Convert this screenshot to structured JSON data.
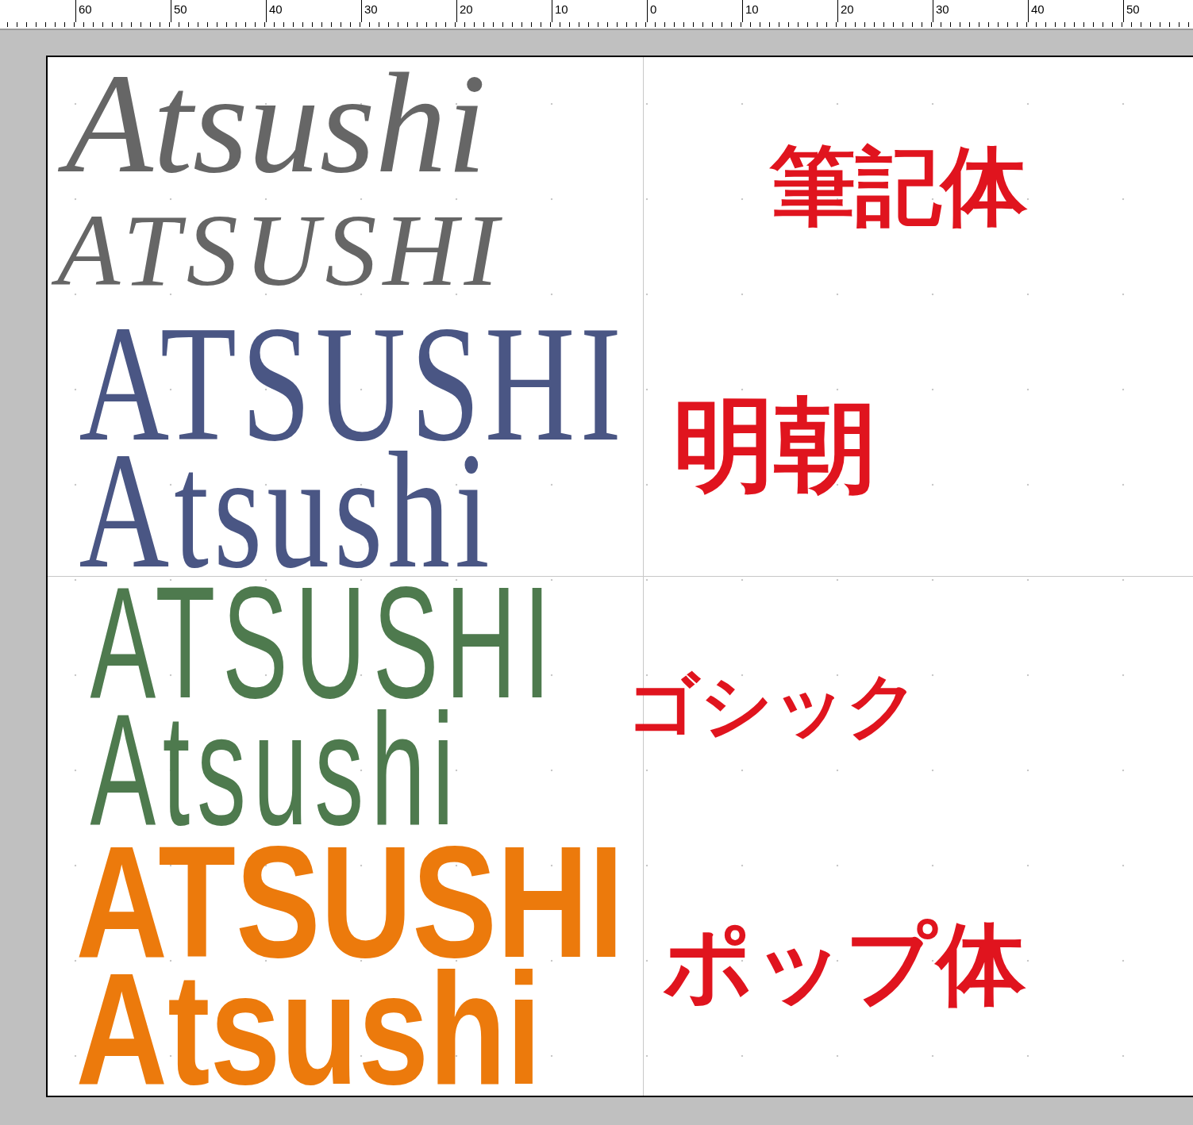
{
  "ruler": {
    "labels": [
      "60",
      "50",
      "40",
      "30",
      "20",
      "10",
      "0",
      "10",
      "20",
      "30",
      "40",
      "50"
    ]
  },
  "canvas": {
    "samples": [
      {
        "kind": "script",
        "color": "#666666",
        "lines": [
          "Atsushi",
          "ATSUSHI"
        ],
        "label": "筆記体"
      },
      {
        "kind": "mincho",
        "color": "#4a5684",
        "lines": [
          "ATSUSHI",
          "Atsushi"
        ],
        "label": "明朝"
      },
      {
        "kind": "gothic",
        "color": "#4e7a4e",
        "lines": [
          "ATSUSHI",
          "Atsushi"
        ],
        "label": "ゴシック"
      },
      {
        "kind": "pop",
        "color": "#ec7a0c",
        "lines": [
          "ATSUSHI",
          "Atsushi"
        ],
        "label": "ポップ体"
      }
    ]
  }
}
